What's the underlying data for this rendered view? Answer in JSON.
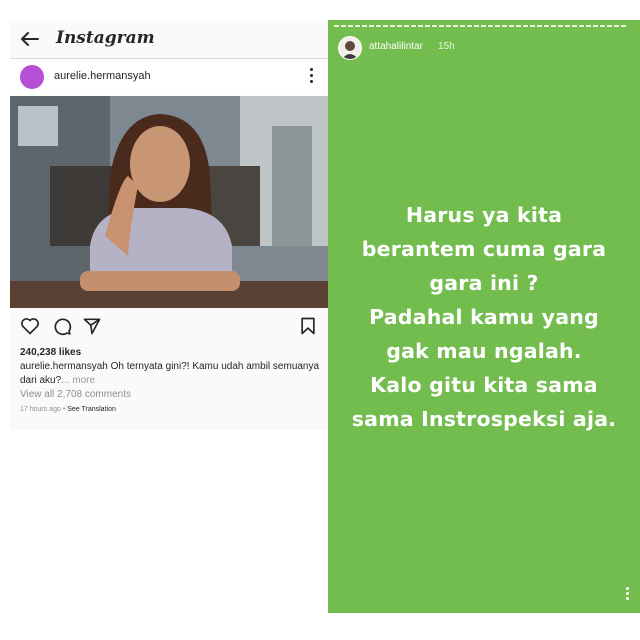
{
  "post": {
    "app_title": "Instagram",
    "username": "aurelie.hermansyah",
    "likes": "240,238 likes",
    "caption_user": "aurelie.hermansyah",
    "caption_text": " Oh ternyata gini?! Kamu udah ambil semuanya dari aku?",
    "caption_more": "... more",
    "view_comments": "View all 2,708 comments",
    "time_ago": "17 hours ago",
    "separator": " • ",
    "see_translation": "See Translation",
    "icons": [
      "back-arrow-icon",
      "more-options-icon",
      "heart-icon",
      "comment-icon",
      "share-icon",
      "bookmark-icon"
    ]
  },
  "story": {
    "username": "attahalilintar",
    "time": "15h",
    "background_color": "#72bd4e",
    "lines": [
      "Harus ya kita",
      "berantem cuma gara",
      "gara ini ?",
      "Padahal kamu yang",
      "gak mau ngalah.",
      "Kalo gitu kita sama",
      "sama Instrospeksi aja."
    ],
    "icons": [
      "story-more-icon"
    ]
  }
}
